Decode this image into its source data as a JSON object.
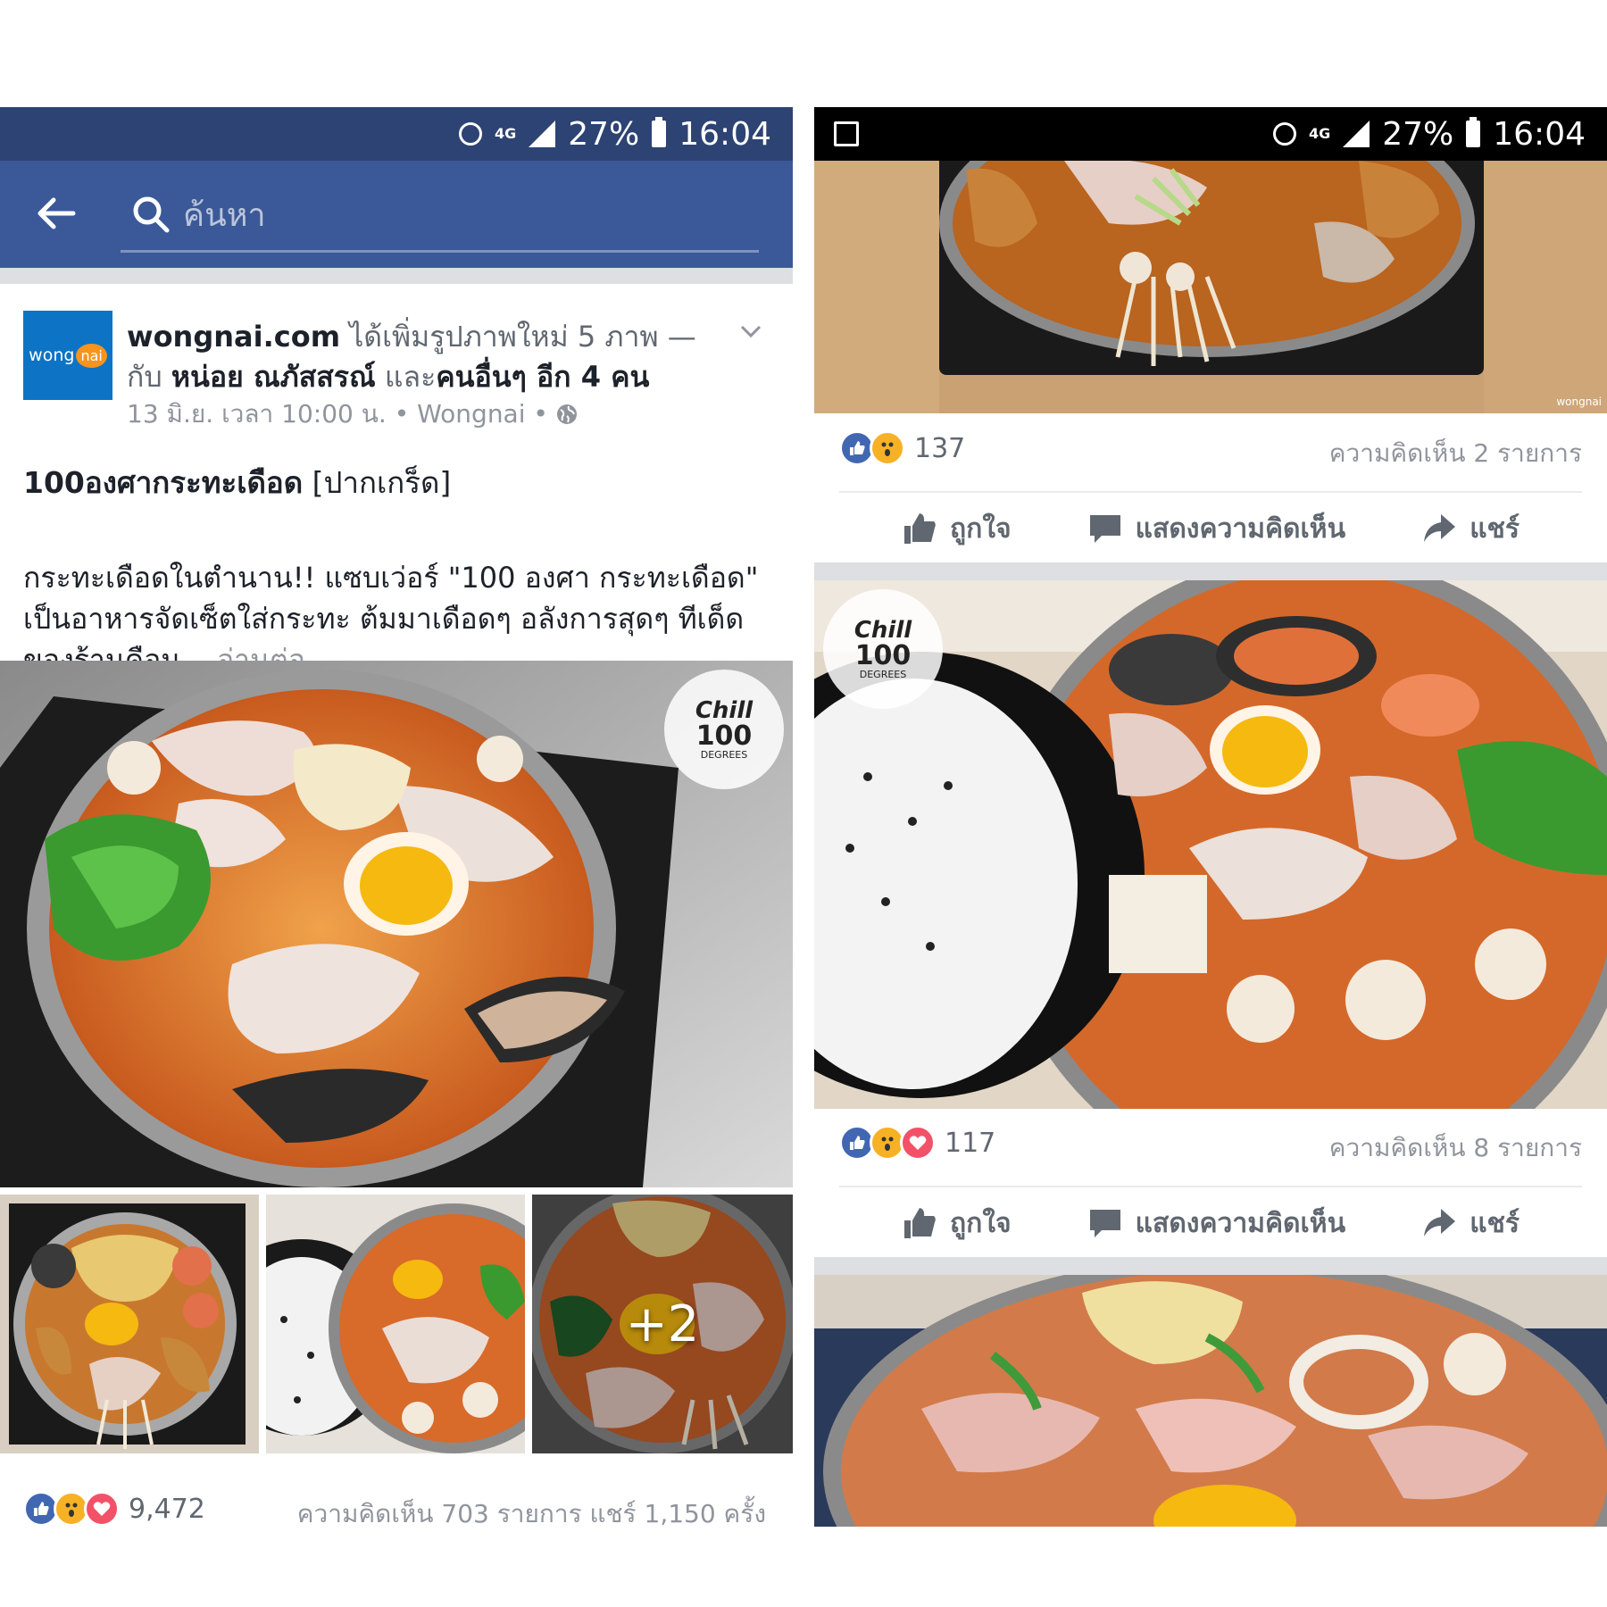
{
  "left": {
    "status_bar": {
      "network": "4G",
      "battery": "27%",
      "time": "16:04"
    },
    "search": {
      "placeholder": "ค้นหา"
    },
    "post": {
      "avatar_text": "wong",
      "avatar_badge": "nai",
      "page_name": "wongnai.com",
      "action_text": "ได้เพิ่มรูปภาพใหม่ 5 ภาพ —",
      "with_prefix": "กับ",
      "tagged_person": "หน่อย ณภัสสรณ์",
      "and_text": "และ",
      "others": "คนอื่นๆ อีก 4 คน",
      "date": "13 มิ.ย. เวลา 10:00 น. • Wongnai •",
      "title": "100องศากระทะเดือด",
      "location": "[ปากเกร็ด]",
      "body": "กระทะเดือดในตำนาน!! แซบเว่อร์ \"100 องศา กระทะเดือด\" เป็นอาหารจัดเซ็ตใส่กระทะ ต้มมาเดือดๆ อลังการสุดๆ ทีเด็ดของร้านคือน...",
      "see_more": "อ่านต่อ",
      "more_photos": "+2",
      "reaction_count": "9,472",
      "comments_shares": "ความคิดเห็น 703 รายการ แชร์ 1,150 ครั้ง",
      "watermark": {
        "brand": "Chill",
        "number": "100",
        "caption": "DEGREES"
      }
    }
  },
  "right": {
    "status_bar": {
      "network": "4G",
      "battery": "27%",
      "time": "16:04"
    },
    "photo1": {
      "reaction_count": "137",
      "comments": "ความคิดเห็น 2 รายการ",
      "watermark": "wongnai"
    },
    "photo2": {
      "reaction_count": "117",
      "comments": "ความคิดเห็น 8 รายการ",
      "watermark": {
        "brand": "Chill",
        "number": "100",
        "caption": "DEGREES"
      }
    },
    "actions": {
      "like": "ถูกใจ",
      "comment": "แสดงความคิดเห็น",
      "share": "แชร์"
    }
  },
  "colors": {
    "facebook_blue": "#3b5998",
    "status_dark_blue": "#2d4373",
    "like_blue": "#4267b2",
    "wow_yellow": "#f7b125",
    "love_red": "#f25268",
    "text_grey": "#90949c",
    "wongnai_blue": "#0d74c5"
  }
}
